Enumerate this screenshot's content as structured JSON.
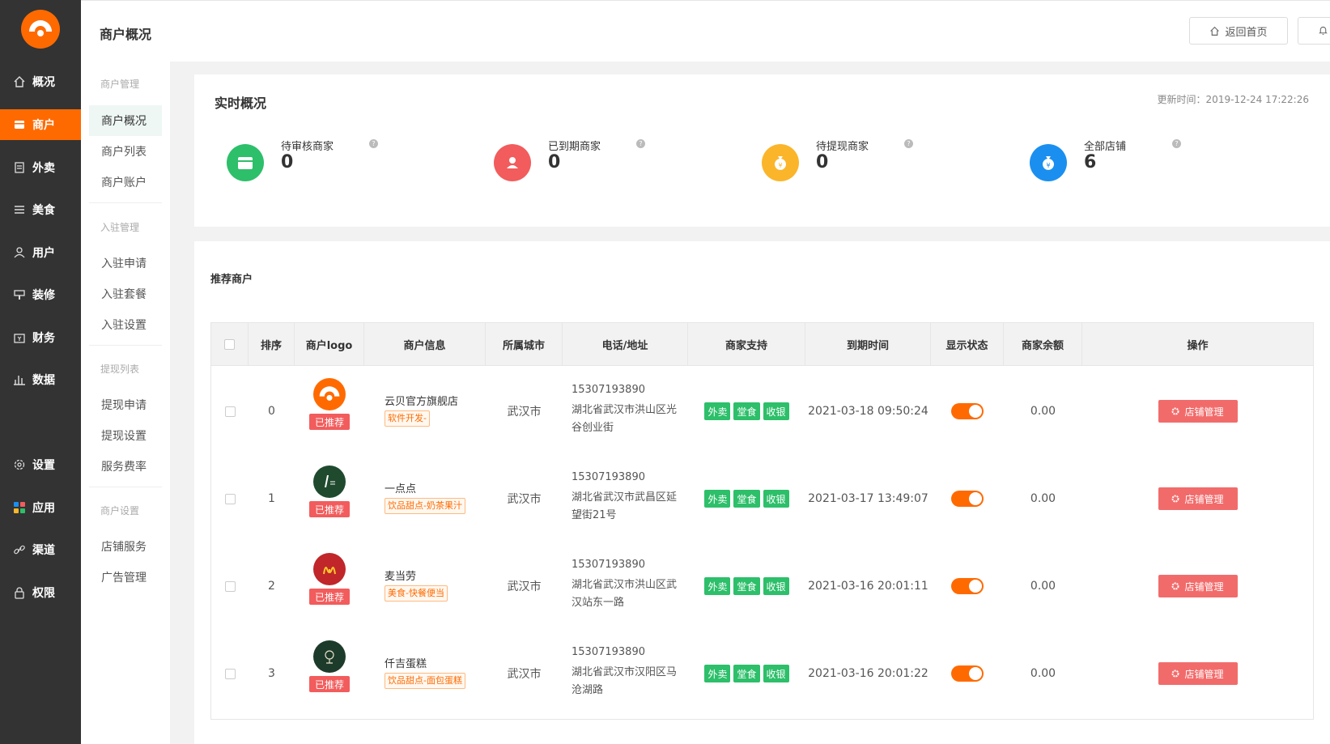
{
  "sidebar": {
    "items": [
      {
        "label": "概况",
        "icon": "home-icon"
      },
      {
        "label": "商户",
        "icon": "store-icon",
        "active": true
      },
      {
        "label": "外卖",
        "icon": "document-icon"
      },
      {
        "label": "美食",
        "icon": "menu-icon"
      },
      {
        "label": "用户",
        "icon": "user-icon"
      },
      {
        "label": "装修",
        "icon": "brush-icon"
      },
      {
        "label": "财务",
        "icon": "wallet-icon"
      },
      {
        "label": "数据",
        "icon": "bar-chart-icon"
      },
      {
        "label": "设置",
        "icon": "gear-icon"
      },
      {
        "label": "应用",
        "icon": "apps-icon"
      },
      {
        "label": "渠道",
        "icon": "link-icon"
      },
      {
        "label": "权限",
        "icon": "lock-icon"
      }
    ]
  },
  "header": {
    "title": "商户概况",
    "home_label": "返回首页"
  },
  "subnav": {
    "group1": "商户管理",
    "item1": "商户概况",
    "item2": "商户列表",
    "item3": "商户账户",
    "group2": "入驻管理",
    "item4": "入驻申请",
    "item5": "入驻套餐",
    "item6": "入驻设置",
    "group3": "提现列表",
    "item7": "提现申请",
    "item8": "提现设置",
    "item9": "服务费率",
    "group4": "商户设置",
    "item10": "店铺服务",
    "item11": "广告管理"
  },
  "overview": {
    "title": "实时概况",
    "update_time": "更新时间：2019-12-24 17:22:26",
    "stats": [
      {
        "label": "待审核商家",
        "value": "0",
        "color": "#2dbf6a"
      },
      {
        "label": "已到期商家",
        "value": "0",
        "color": "#f25c5c"
      },
      {
        "label": "待提现商家",
        "value": "0",
        "color": "#fbb52b"
      },
      {
        "label": "全部店铺",
        "value": "6",
        "color": "#1a8ff0"
      }
    ]
  },
  "recommend": {
    "title": "推荐商户",
    "columns": [
      "排序",
      "商户logo",
      "商户信息",
      "所属城市",
      "电话/地址",
      "商家支持",
      "到期时间",
      "显示状态",
      "商家余额",
      "操作"
    ],
    "recommended_label": "已推荐",
    "supports": [
      "外卖",
      "堂食",
      "收银"
    ],
    "op_label": "店铺管理",
    "rows": [
      {
        "sort": "0",
        "name": "云贝官方旗舰店",
        "tag": "软件开发-",
        "city": "武汉市",
        "phone": "15307193890",
        "address": "湖北省武汉市洪山区光谷创业街",
        "expire": "2021-03-18 09:50:24",
        "balance": "0.00"
      },
      {
        "sort": "1",
        "name": "一点点",
        "tag": "饮品甜点-奶茶果汁",
        "city": "武汉市",
        "phone": "15307193890",
        "address": "湖北省武汉市武昌区延望街21号",
        "expire": "2021-03-17 13:49:07",
        "balance": "0.00"
      },
      {
        "sort": "2",
        "name": "麦当劳",
        "tag": "美食-快餐便当",
        "city": "武汉市",
        "phone": "15307193890",
        "address": "湖北省武汉市洪山区武汉站东一路",
        "expire": "2021-03-16 20:01:11",
        "balance": "0.00"
      },
      {
        "sort": "3",
        "name": "仟吉蛋糕",
        "tag": "饮品甜点-面包蛋糕",
        "city": "武汉市",
        "phone": "15307193890",
        "address": "湖北省武汉市汉阳区马沧湖路",
        "expire": "2021-03-16 20:01:22",
        "balance": "0.00"
      }
    ]
  }
}
